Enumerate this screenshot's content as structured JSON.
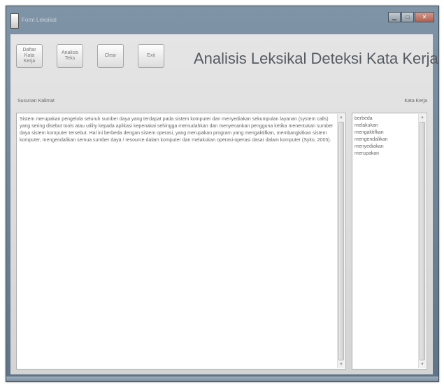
{
  "window": {
    "title": "Form Leksikal",
    "min_glyph": "▁",
    "max_glyph": "□",
    "close_glyph": "✕"
  },
  "toolbar": {
    "daftar_label": "Daftar\nKata Kerja",
    "analisis_label": "Analisis\nTeks",
    "clear_label": "Clear",
    "exit_label": "Exit"
  },
  "app_title": "Analisis Leksikal Deteksi Kata Kerja",
  "labels": {
    "input": "Susunan Kalimat",
    "output": "Kata Kerja"
  },
  "input_text": "Sistem merupakan pengelola seluruh sumber daya yang terdapat pada sistem komputer dan menyediakan sekumpulan layanan (system calls) yang sering disebut tools atau utility kepada aplikasi kepenakai sehingga memudahkan dan menyenankan pengguna ketika menentukan sumber daya sistem komputer tersebut. Hal ini berbeda dengan sistem operasi, yang merupakan program yang mengaktifkan, membangkitkan sistem komputer, mengendalikan semua sumber daya / resource dalam komputer dan melakukan operasi-operasi dasar dalam komputer (Syito, 2005).",
  "output_items": [
    "berbeda",
    "melakukan",
    "mengaktifkan",
    "mengendalikan",
    "menyediakan",
    "merupakan"
  ],
  "colors": {
    "frame": "#6f8496",
    "client": "#dddddd",
    "title_text": "#555b61"
  },
  "icons": {
    "scroll_up": "▲",
    "scroll_down": "▼"
  }
}
